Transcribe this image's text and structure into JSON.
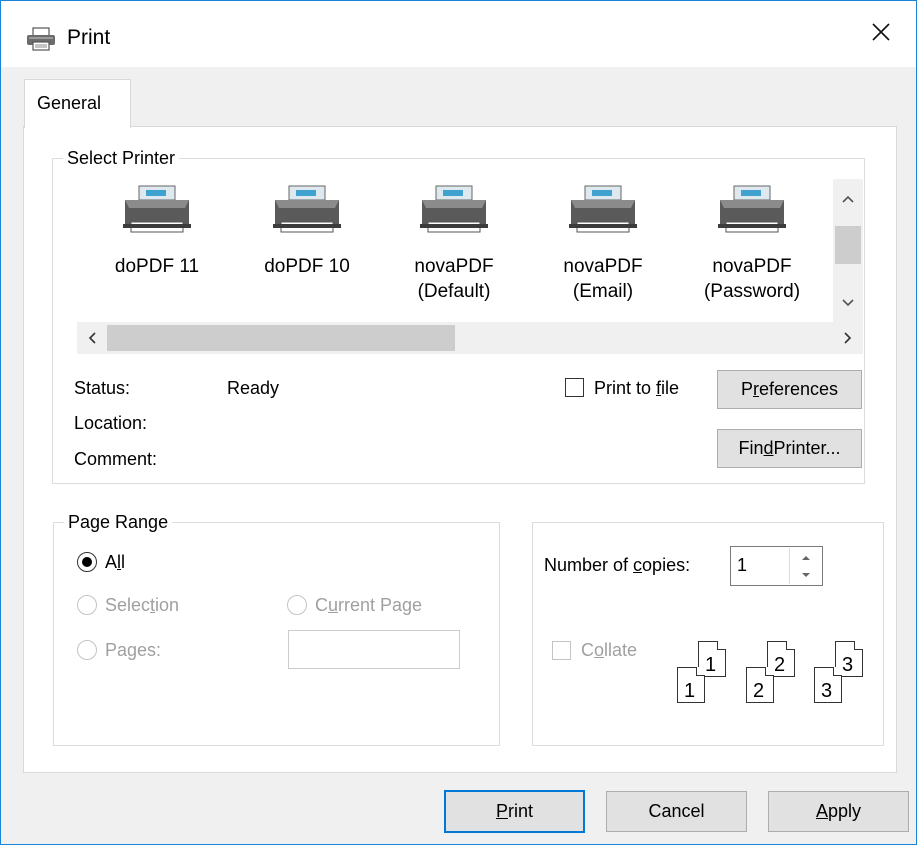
{
  "window": {
    "title": "Print",
    "close_symbol": "✕"
  },
  "tabs": [
    {
      "label": "General"
    }
  ],
  "select_printer": {
    "title": "Select Printer",
    "printers": [
      {
        "name": "doPDF 11",
        "sub": ""
      },
      {
        "name": "doPDF 10",
        "sub": ""
      },
      {
        "name": "novaPDF",
        "sub": "(Default)"
      },
      {
        "name": "novaPDF",
        "sub": "(Email)"
      },
      {
        "name": "novaPDF",
        "sub": "(Password)"
      }
    ],
    "status_label": "Status:",
    "status_value": "Ready",
    "location_label": "Location:",
    "location_value": "",
    "comment_label": "Comment:",
    "comment_value": "",
    "print_to_file": {
      "label_pre": "Print to ",
      "label_key": "f",
      "label_post": "ile",
      "checked": false
    },
    "preferences_button": {
      "pre": "P",
      "key": "r",
      "post": "eferences"
    },
    "find_printer_button": {
      "pre": "Fin",
      "key": "d",
      "post": " Printer..."
    }
  },
  "page_range": {
    "title": "Page Range",
    "options": {
      "all": {
        "pre": "A",
        "key": "l",
        "post": "l",
        "checked": true,
        "enabled": true
      },
      "selection": {
        "pre": "Selec",
        "key": "t",
        "post": "ion",
        "enabled": false
      },
      "current_page": {
        "pre": "C",
        "key": "u",
        "post": "rrent Page",
        "enabled": false
      },
      "pages": {
        "pre": "Pa",
        "key": "g",
        "post": "es:",
        "enabled": false
      }
    },
    "pages_value": ""
  },
  "copies": {
    "label_pre": "Number of ",
    "label_key": "c",
    "label_post": "opies:",
    "value": "1",
    "collate": {
      "pre": "C",
      "key": "o",
      "post": "llate",
      "checked": false,
      "enabled": false
    },
    "collate_pages": [
      "1",
      "1",
      "2",
      "2",
      "3",
      "3"
    ]
  },
  "buttons": {
    "print": {
      "pre": "",
      "key": "P",
      "post": "rint"
    },
    "cancel": {
      "pre": "Cancel",
      "key": "",
      "post": ""
    },
    "apply": {
      "pre": "",
      "key": "A",
      "post": "pply"
    }
  }
}
